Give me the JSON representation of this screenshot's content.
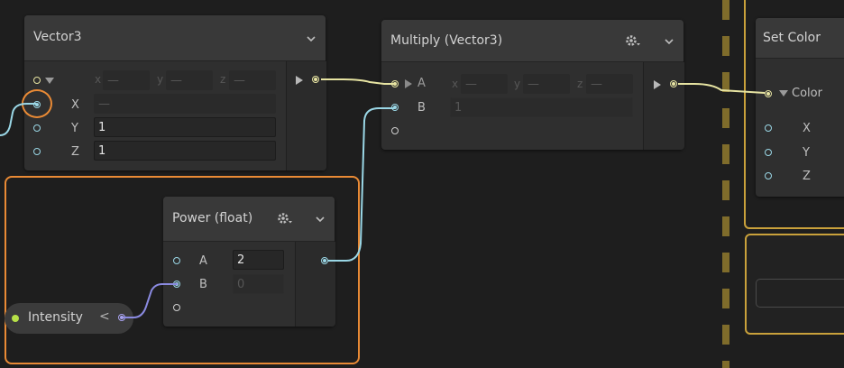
{
  "colors": {
    "background": "#1e1e1e",
    "node_body": "#2f2f2f",
    "node_header": "#393939",
    "wire_yellow": "#e7e4a2",
    "wire_cyan": "#9ad7e6",
    "wire_purple": "#8a8ae0",
    "selection_orange": "#e98a35",
    "section_outline": "#c9a13b",
    "property_port_green": "#b6e048"
  },
  "vector3_node": {
    "title": "Vector3",
    "compound_labels": {
      "x": "x",
      "y": "y",
      "z": "z"
    },
    "compound_values": {
      "x": "—",
      "y": "—",
      "z": "—"
    },
    "ports": [
      {
        "label": "X",
        "value": "—"
      },
      {
        "label": "Y",
        "value": "1"
      },
      {
        "label": "Z",
        "value": "1"
      }
    ]
  },
  "multiply_node": {
    "title": "Multiply (Vector3)",
    "port_a": {
      "label": "A",
      "x_label": "x",
      "y_label": "y",
      "z_label": "z",
      "x": "—",
      "y": "—",
      "z": "—"
    },
    "port_b": {
      "label": "B",
      "value": "1"
    }
  },
  "power_node": {
    "title": "Power (float)",
    "port_a": {
      "label": "A",
      "value": "2"
    },
    "port_b": {
      "label": "B",
      "value": "0"
    }
  },
  "intensity_property": {
    "label": "Intensity",
    "chevron": "<"
  },
  "set_color_node": {
    "title": "Set Color",
    "color_label": "Color",
    "ports": [
      "X",
      "Y",
      "Z"
    ]
  },
  "icons": [
    "chevron-down-icon",
    "gear-icon",
    "triangle-right-icon",
    "triangle-down-icon"
  ]
}
